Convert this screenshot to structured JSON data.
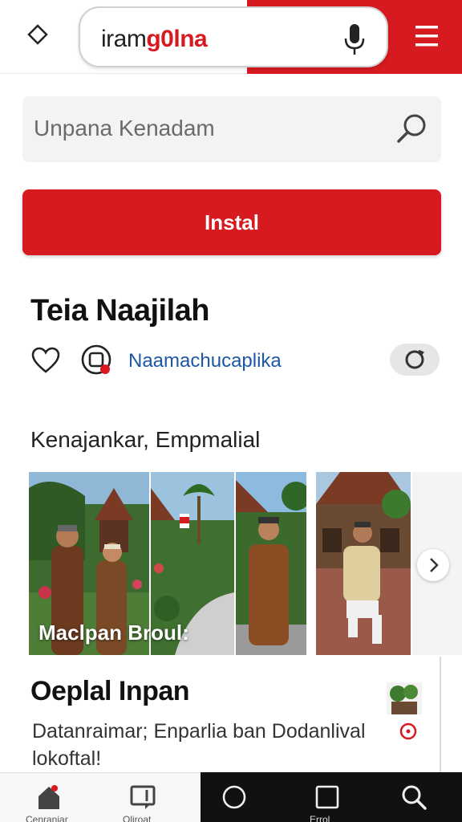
{
  "browser": {
    "url_part1": "iram",
    "url_part2": "g0lna"
  },
  "search": {
    "placeholder": "Unpana Kenadam"
  },
  "install_button": {
    "label": "Instal"
  },
  "header": {
    "title": "Teia Naajilah",
    "link_text": "Naamachucaplika"
  },
  "section": {
    "label": "Kenajankar, Empmalial"
  },
  "gallery": {
    "caption": "Maclpan Broul:"
  },
  "article": {
    "title": "Oeplal Inpan",
    "body_line1": "Datanraimar; Enparlia ban Dodanlival",
    "body_line2": "lokoftal!"
  },
  "bottom_nav": {
    "items": [
      {
        "label": "Cenraniar",
        "icon": "home-icon"
      },
      {
        "label": "Oliroat",
        "icon": "bookmark-icon"
      },
      {
        "label": "",
        "icon": "circle-icon"
      },
      {
        "label": "Errol",
        "icon": "square-icon"
      },
      {
        "label": "",
        "icon": "search-icon"
      }
    ]
  },
  "colors": {
    "brand_red": "#d71920",
    "link_blue": "#1d57a8"
  }
}
